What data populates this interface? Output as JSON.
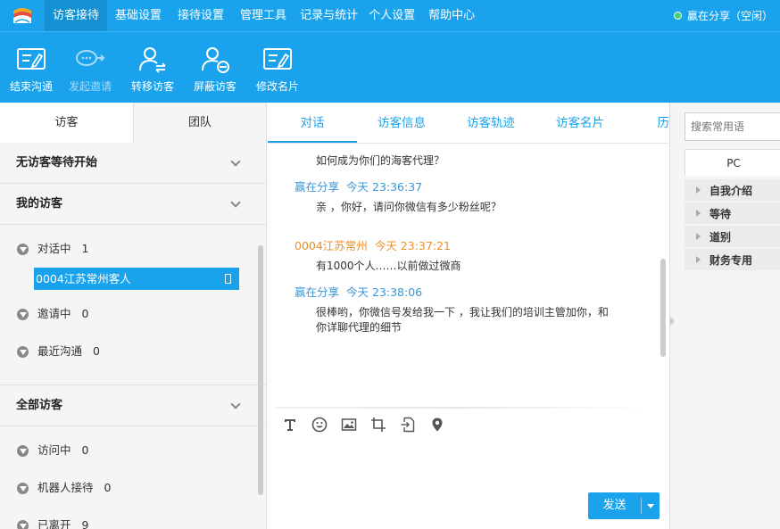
{
  "nav": {
    "items": [
      "访客接待",
      "基础设置",
      "接待设置",
      "管理工具",
      "记录与统计",
      "个人设置",
      "帮助中心"
    ],
    "active": 0,
    "status": "赢在分享（空闲）",
    "status_color": "#3fd36a"
  },
  "toolbar": {
    "end_chat": "结束沟通",
    "invite": "发起邀请",
    "transfer": "转移访客",
    "block": "屏蔽访客",
    "edit_card": "修改名片"
  },
  "left": {
    "tabs": [
      "访客",
      "团队"
    ],
    "section_waiting": "无访客等待开始",
    "section_mine": "我的访客",
    "chatting_label": "对话中",
    "chatting_count": "1",
    "visitor_name": "0004江苏常州客人",
    "inviting_label": "邀请中",
    "inviting_count": "0",
    "recent_label": "最近沟通",
    "recent_count": "0",
    "section_all": "全部访客",
    "visiting_label": "访问中",
    "visiting_count": "0",
    "robot_label": "机器人接待",
    "robot_count": "0",
    "left_label": "已离开",
    "left_count": "9"
  },
  "chat": {
    "tabs": [
      "对话",
      "访客信息",
      "访客轨迹",
      "访客名片",
      "历史"
    ],
    "messages": [
      {
        "text": "如何成为你们的海客代理？"
      },
      {
        "sender": "赢在分享",
        "time": "今天 23:36:37",
        "text": "亲 ，你好，请问你微信有多少粉丝呢？"
      },
      {
        "sender": "0004江苏常州",
        "time": "今天 23:37:21",
        "text": "有1000个人……以前做过微商"
      },
      {
        "sender": "赢在分享",
        "time": "今天 23:38:06",
        "text": "很棒哟，你微信号发给我一下 ，我让我们的培训主管加你，和你详聊代理的细节"
      }
    ],
    "send_label": "发送"
  },
  "right": {
    "search_placeholder": "搜索常用语",
    "tab": "PC",
    "items": [
      "自我介绍",
      "等待",
      "道别",
      "财务专用"
    ]
  },
  "colors": {
    "brand": "#1aa3ec",
    "agent_name": "#3a97d4",
    "customer_name": "#e8912f"
  }
}
